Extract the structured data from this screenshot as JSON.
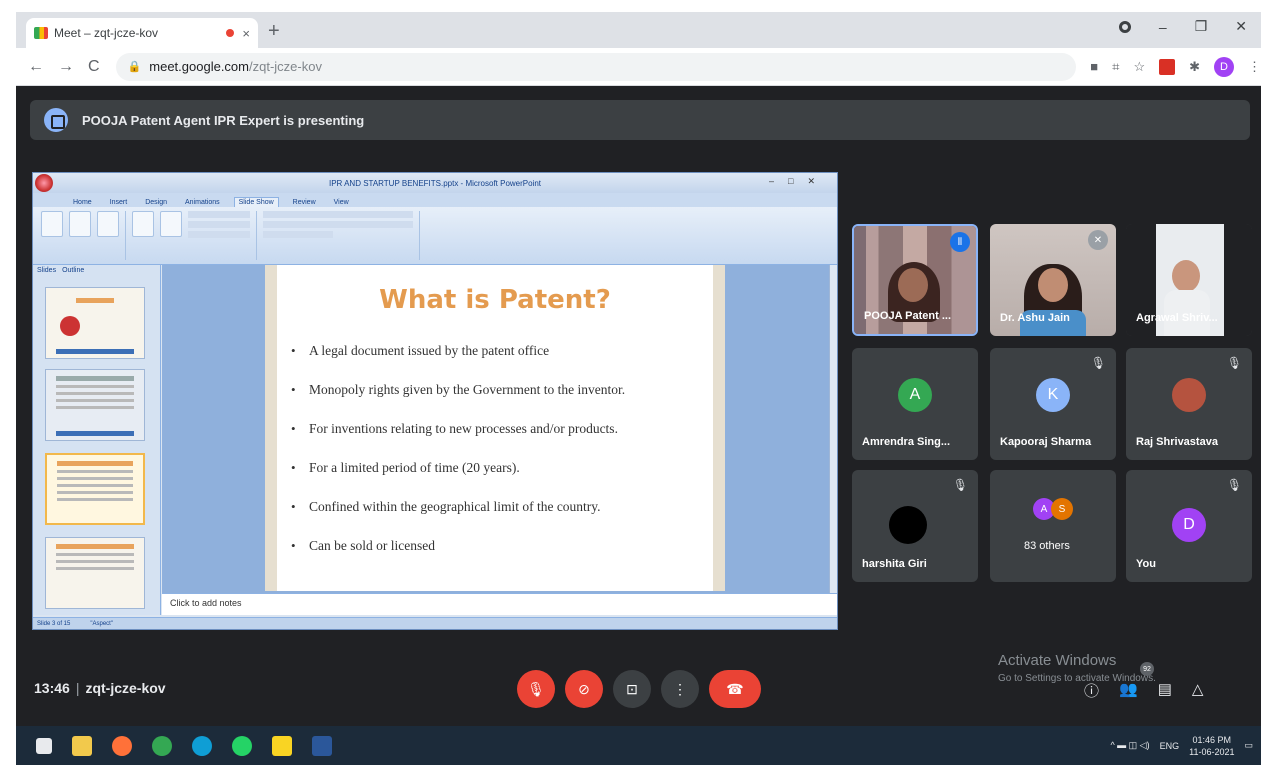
{
  "browser": {
    "tab_title": "Meet – zqt-jcze-kov",
    "tab_close": "×",
    "new_tab": "+",
    "url_host": "meet.google.com",
    "url_path": "/zqt-jcze-kov",
    "profile_initial": "D",
    "window_controls": {
      "minimize": "–",
      "maximize": "❐",
      "close": "✕"
    },
    "nav": {
      "back": "←",
      "forward": "→",
      "reload": "C"
    }
  },
  "banner": {
    "text": "POOJA Patent Agent IPR Expert is presenting"
  },
  "presentation": {
    "window_title": "IPR AND STARTUP BENEFITS.pptx - Microsoft PowerPoint",
    "ribbon_tabs": [
      "Home",
      "Insert",
      "Design",
      "Animations",
      "Slide Show",
      "Review",
      "View"
    ],
    "active_ribbon_tab": "Slide Show",
    "pane_tabs": [
      "Slides",
      "Outline"
    ],
    "slide_title": "What is Patent?",
    "bullets": [
      "A legal document issued by the patent office",
      "Monopoly rights given by the Government to the inventor.",
      "For inventions relating to new processes and/or products.",
      "For a limited period of time (20 years).",
      "Confined within the geographical limit of the country.",
      "Can be sold or licensed"
    ],
    "bullet_char": "•",
    "notes_placeholder": "Click to add notes",
    "status_left": "Slide 3 of 15",
    "status_theme": "\"Aspect\""
  },
  "participants": [
    {
      "name": "POOJA Patent ...",
      "type": "video",
      "speaking": true
    },
    {
      "name": "Dr. Ashu Jain",
      "type": "video",
      "muted": true
    },
    {
      "name": "Agrawal Shriv...",
      "type": "video"
    },
    {
      "name": "Amrendra Sing...",
      "initial": "A",
      "color": "#34a853",
      "muted": false
    },
    {
      "name": "Kapooraj Sharma",
      "initial": "K",
      "color": "#8ab4f8",
      "muted": true
    },
    {
      "name": "Raj Shrivastava",
      "muted": true
    },
    {
      "name": "harshita Giri",
      "muted": true
    },
    {
      "name": "83 others",
      "initials": [
        "A",
        "S"
      ]
    },
    {
      "name": "You",
      "initial": "D",
      "color": "#a142f4",
      "muted": true
    }
  ],
  "meeting": {
    "time": "13:46",
    "code": "zqt-jcze-kov",
    "participant_count": "92"
  },
  "activate_windows": {
    "title": "Activate Windows",
    "subtitle": "Go to Settings to activate Windows."
  },
  "taskbar": {
    "lang": "ENG",
    "time": "01:46 PM",
    "date": "11-06-2021"
  },
  "colors": {
    "meet_bg": "#202124",
    "tile_bg": "#3c4043",
    "danger": "#ea4335",
    "accent": "#8ab4f8",
    "slide_title": "#e49b4f"
  }
}
